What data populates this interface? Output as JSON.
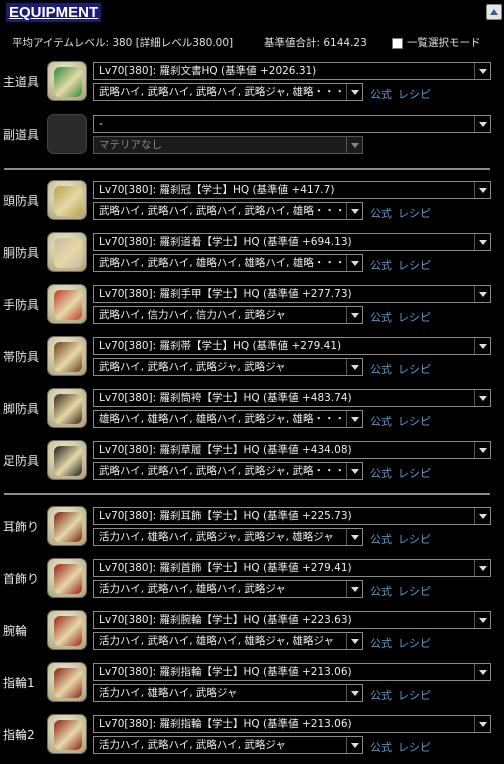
{
  "header": {
    "title": "EQUIPMENT",
    "avg_item_level": "平均アイテムレベル: 380 [詳細レベル380.00]",
    "total_base": "基準値合計: 6144.23",
    "list_mode_label": "一覧選択モード"
  },
  "links": {
    "official": "公式",
    "recipe": "レシピ"
  },
  "slots": [
    {
      "label": "主道具",
      "item": "Lv70[380]: 羅刹文書HQ (基準値 +2026.31)",
      "materia": "武略ハイ, 武略ハイ, 武略ハイ, 武略ジャ, 雄略・・・",
      "icon_color": "#2f8a3a",
      "icon": "book-icon"
    },
    {
      "label": "副道具",
      "item": "-",
      "materia": "マテリアなし",
      "empty": true
    },
    {
      "label": "頭防具",
      "item": "Lv70[380]: 羅刹冠【学士】HQ (基準値 +417.7)",
      "materia": "武略ハイ, 武略ハイ, 武略ハイ, 武略ハイ, 雄略・・・",
      "icon_color": "#b9a34a",
      "icon": "crown-icon"
    },
    {
      "label": "胴防具",
      "item": "Lv70[380]: 羅刹道着【学士】HQ (基準値 +694.13)",
      "materia": "武略ハイ, 武略ハイ, 雄略ハイ, 雄略ハイ, 雄略・・・",
      "icon_color": "#c9b9a0",
      "icon": "robe-icon"
    },
    {
      "label": "手防具",
      "item": "Lv70[380]: 羅刹手甲【学士】HQ (基準値 +277.73)",
      "materia": "武略ハイ, 信力ハイ, 信力ハイ, 武略ジャ",
      "icon_color": "#c0392b",
      "icon": "gloves-icon"
    },
    {
      "label": "帯防具",
      "item": "Lv70[380]: 羅刹帯【学士】HQ (基準値 +279.41)",
      "materia": "武略ハイ, 武略ハイ, 武略ジャ, 武略ジャ",
      "icon_color": "#6b3b1d",
      "icon": "belt-icon"
    },
    {
      "label": "脚防具",
      "item": "Lv70[380]: 羅刹筒袴【学士】HQ (基準値 +483.74)",
      "materia": "雄略ハイ, 雄略ハイ, 雄略ハイ, 武略ジャ, 雄略・・・",
      "icon_color": "#3a2418",
      "icon": "legs-icon"
    },
    {
      "label": "足防具",
      "item": "Lv70[380]: 羅刹草履【学士】HQ (基準値 +434.08)",
      "materia": "武略ハイ, 武略ハイ, 武略ハイ, 武略ジャ, 武略・・・",
      "icon_color": "#1d1d1d",
      "icon": "shoes-icon"
    },
    {
      "label": "耳飾り",
      "item": "Lv70[380]: 羅刹耳飾【学士】HQ (基準値 +225.73)",
      "materia": "活力ハイ, 雄略ハイ, 武略ジャ, 武略ジャ, 雄略ジャ",
      "icon_color": "#7a1f14",
      "icon": "earring-icon"
    },
    {
      "label": "首飾り",
      "item": "Lv70[380]: 羅刹首飾【学士】HQ (基準値 +279.41)",
      "materia": "活力ハイ, 武略ハイ, 雄略ハイ, 武略ジャ",
      "icon_color": "#9b1b1b",
      "icon": "necklace-icon"
    },
    {
      "label": "腕輪",
      "item": "Lv70[380]: 羅刹腕輪【学士】HQ (基準値 +223.63)",
      "materia": "活力ハイ, 武略ハイ, 雄略ハイ, 雄略ジャ, 雄略ジャ",
      "icon_color": "#a0231b",
      "icon": "bracelet-icon"
    },
    {
      "label": "指輪1",
      "item": "Lv70[380]: 羅刹指輪【学士】HQ (基準値 +213.06)",
      "materia": "活力ハイ, 雄略ハイ, 武略ジャ",
      "icon_color": "#8c1f18",
      "icon": "ring-icon"
    },
    {
      "label": "指輪2",
      "item": "Lv70[380]: 羅刹指輪【学士】HQ (基準値 +213.06)",
      "materia": "活力ハイ, 武略ハイ, 武略ハイ, 武略ジャ",
      "icon_color": "#8c1f18",
      "icon": "ring-icon"
    }
  ]
}
